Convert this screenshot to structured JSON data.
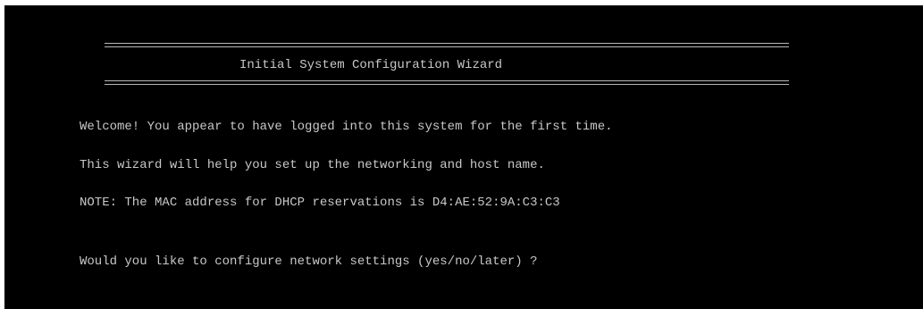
{
  "terminal": {
    "title": "Initial System Configuration Wizard",
    "lines": [
      "Welcome! You appear to have logged into this system for the first time.",
      "This wizard will help you set up the networking and host name.",
      "NOTE: The MAC address for DHCP reservations is D4:AE:52:9A:C3:C3",
      "Would you like to configure network settings (yes/no/later) ?"
    ],
    "colors": {
      "background": "#000000",
      "foreground": "#c8c8c8"
    }
  }
}
